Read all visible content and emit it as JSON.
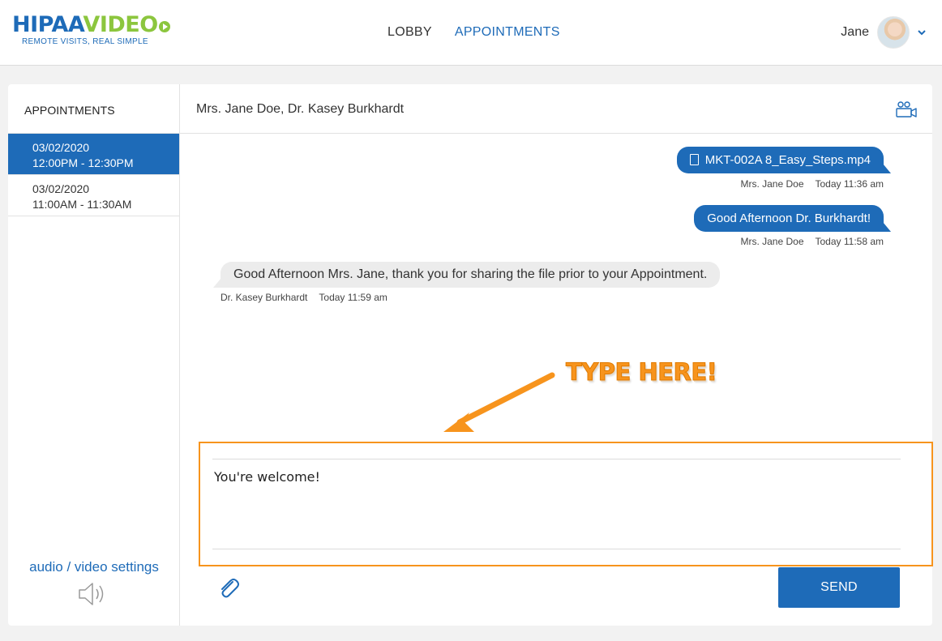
{
  "brand": {
    "name_part1": "HIPAA",
    "name_part2": "VIDEO",
    "tagline": "REMOTE VISITS, REAL SIMPLE",
    "colors": {
      "primary": "#1e6bb8",
      "accent": "#8cc63e"
    }
  },
  "nav": {
    "lobby": "LOBBY",
    "appointments": "APPOINTMENTS",
    "active": "appointments"
  },
  "user": {
    "name": "Jane",
    "menu_icon": "chevron-down-icon"
  },
  "sidebar": {
    "title": "APPOINTMENTS",
    "appointments": [
      {
        "date": "03/02/2020",
        "time": "12:00PM - 12:30PM",
        "selected": true
      },
      {
        "date": "03/02/2020",
        "time": "11:00AM - 11:30AM",
        "selected": false
      }
    ],
    "settings_label": "audio / video settings",
    "settings_icon": "speaker-icon"
  },
  "conversation": {
    "participants": "Mrs. Jane Doe, Dr. Kasey Burkhardt",
    "video_icon": "video-call-icon",
    "messages": [
      {
        "direction": "outgoing",
        "type": "file",
        "text": "MKT-002A 8_Easy_Steps.mp4",
        "sender": "Mrs. Jane Doe",
        "time": "Today 11:36 am"
      },
      {
        "direction": "outgoing",
        "type": "text",
        "text": "Good Afternoon Dr. Burkhardt!",
        "sender": "Mrs. Jane Doe",
        "time": "Today 11:58 am"
      },
      {
        "direction": "incoming",
        "type": "text",
        "text": "Good Afternoon Mrs. Jane, thank you for sharing the file prior to your Appointment.",
        "sender": "Dr. Kasey Burkhardt",
        "time": "Today 11:59 am"
      }
    ]
  },
  "annotation": {
    "text": "TYPE HERE!",
    "color": "#f7941d"
  },
  "composer": {
    "value": "You're welcome!",
    "attach_icon": "paperclip-icon",
    "send_label": "SEND"
  }
}
